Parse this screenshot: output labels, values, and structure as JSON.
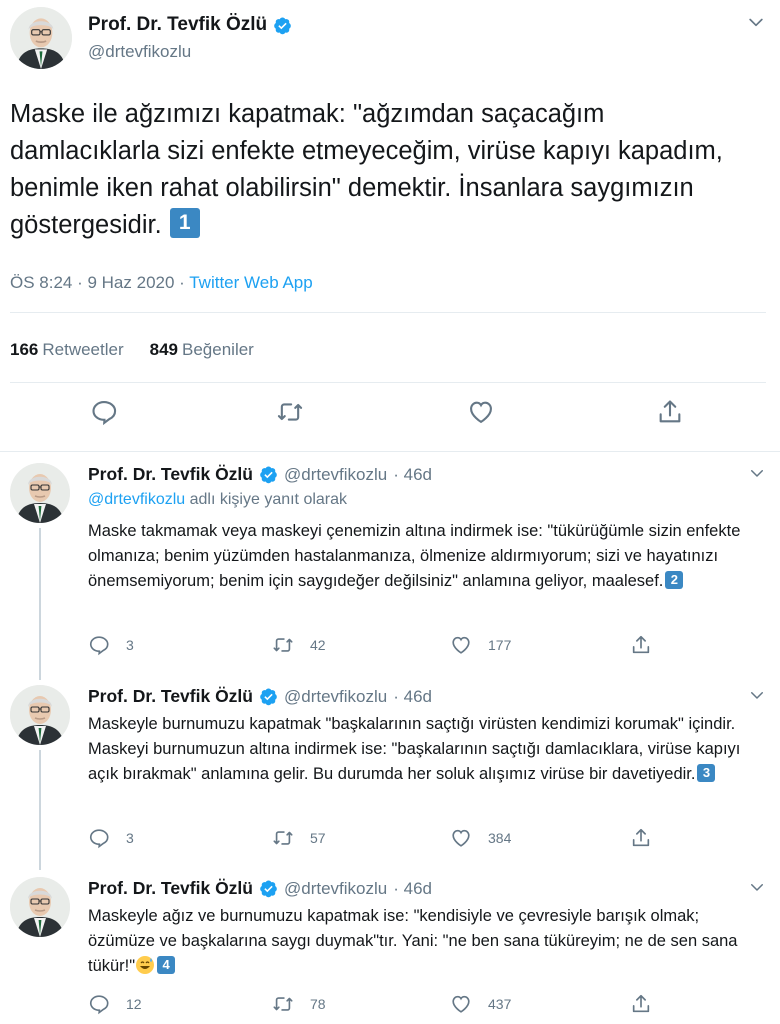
{
  "main": {
    "name": "Prof. Dr. Tevfik Özlü",
    "handle": "@drtevfikozlu",
    "text": "Maske ile ağzımızı kapatmak: \"ağzımdan saçacağım damlacıklarla sizi enfekte etmeyeceğim, virüse kapıyı kapadım, benimle iken rahat olabilirsin\" demektir. İnsanlara saygımızın göstergesidir.",
    "badge": "1",
    "time": "ÖS 8:24 · 9 Haz 2020 · ",
    "app": "Twitter Web App",
    "retweets_count": "166",
    "retweets_label": "Retweetler",
    "likes_count": "849",
    "likes_label": "Beğeniler"
  },
  "replies": [
    {
      "name": "Prof. Dr. Tevfik Özlü",
      "handle": "@drtevfikozlu",
      "age": "· 46d",
      "reply_to_handle": "@drtevfikozlu",
      "reply_to_suffix": " adlı kişiye yanıt olarak",
      "text": "Maske takmamak veya maskeyi çenemizin altına indirmek ise: \"tükürüğümle sizin enfekte olmanıza; benim yüzümden hastalanmanıza, ölmenize aldırmıyorum; sizi ve hayatınızı önemsemiyorum; benim için saygıdeğer değilsiniz\" anlamına geliyor, maalesef.",
      "badge": "2",
      "replies": "3",
      "retweets": "42",
      "likes": "177"
    },
    {
      "name": "Prof. Dr. Tevfik Özlü",
      "handle": "@drtevfikozlu",
      "age": "· 46d",
      "text": "Maskeyle burnumuzu kapatmak \"başkalarının saçtığı virüsten kendimizi korumak\" içindir. Maskeyi burnumuzun altına indirmek ise: \"başkalarının saçtığı damlacıklara, virüse kapıyı açık bırakmak\" anlamına gelir. Bu durumda her soluk alışımız virüse bir davetiyedir.",
      "badge": "3",
      "replies": "3",
      "retweets": "57",
      "likes": "384"
    },
    {
      "name": "Prof. Dr. Tevfik Özlü",
      "handle": "@drtevfikozlu",
      "age": "· 46d",
      "text": "Maskeyle ağız ve burnumuzu kapatmak ise: \"kendisiyle ve çevresiyle barışık olmak; özümüze ve başkalarına saygı duymak\"tır. Yani: \"ne ben sana tüküreyim; ne de sen sana tükür!\"",
      "emoji": "grinning-sweat-emoji",
      "badge": "4",
      "replies": "12",
      "retweets": "78",
      "likes": "437"
    }
  ],
  "colors": {
    "accent": "#1da1f2",
    "text": "#14171a",
    "muted": "#657786",
    "keycap": "#3b88c3",
    "border": "#e6ecf0"
  },
  "icons": [
    "verified-badge-icon",
    "chevron-down-icon",
    "reply-icon",
    "retweet-icon",
    "like-icon",
    "share-icon"
  ]
}
